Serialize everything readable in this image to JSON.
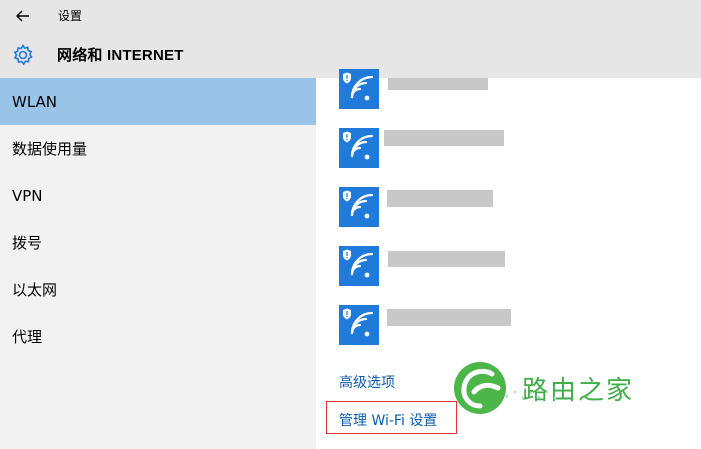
{
  "window": {
    "back_icon": "back-arrow-icon",
    "title": "设置"
  },
  "header": {
    "icon": "gear-icon",
    "section_title": "网络和 INTERNET"
  },
  "sidebar": {
    "items": [
      {
        "label": "WLAN",
        "active": true
      },
      {
        "label": "数据使用量",
        "active": false
      },
      {
        "label": "VPN",
        "active": false
      },
      {
        "label": "拨号",
        "active": false
      },
      {
        "label": "以太网",
        "active": false
      },
      {
        "label": "代理",
        "active": false
      }
    ]
  },
  "networks": {
    "icon": "secured-wifi-icon",
    "count": 5,
    "names_redacted": true
  },
  "links": {
    "advanced": "高级选项",
    "manage_wifi": "管理 Wi-Fi 设置"
  },
  "watermark": {
    "text": "路由之家",
    "color": "#3fae49"
  },
  "colors": {
    "accent": "#1f7ad9",
    "selected_nav": "#99c4e8",
    "chrome": "#e6e6e6",
    "sidebar_bg": "#f2f2f2",
    "link": "#0b5cad",
    "highlight_box": "#e03333"
  }
}
